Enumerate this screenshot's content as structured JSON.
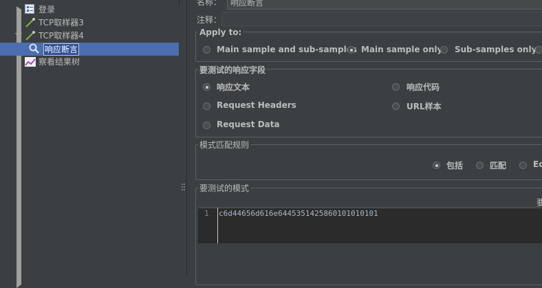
{
  "tree": {
    "items": [
      {
        "label": "登录"
      },
      {
        "label": "TCP取样器3"
      },
      {
        "label": "TCP取样器4"
      },
      {
        "label": "响应断言"
      },
      {
        "label": "察看结果树"
      }
    ]
  },
  "form": {
    "name_label": "名称：",
    "name_value": "响应断言",
    "comment_label": "注释："
  },
  "apply_to": {
    "title": "Apply to:",
    "options": [
      {
        "label": "Main sample and sub-samples",
        "selected": false
      },
      {
        "label": "Main sample only",
        "selected": true
      },
      {
        "label": "Sub-samples only",
        "selected": false
      }
    ]
  },
  "response_field": {
    "title": "要测试的响应字段",
    "options": [
      {
        "label": "响应文本",
        "selected": true
      },
      {
        "label": "响应代码",
        "selected": false
      },
      {
        "label": "Request Headers",
        "selected": false
      },
      {
        "label": "URL样本",
        "selected": false
      },
      {
        "label": "Request Data",
        "selected": false
      }
    ]
  },
  "pattern_rules": {
    "title": "模式匹配规则",
    "options": [
      {
        "label": "包括",
        "selected": true
      },
      {
        "label": "匹配",
        "selected": false
      },
      {
        "label": "Eq",
        "selected": false
      }
    ]
  },
  "patterns": {
    "title": "要测试的模式",
    "header_text": "要",
    "line_number": "1",
    "line_text": "c6d44656d616e6445351425860101010101"
  },
  "icons": {
    "tree": [
      "test-plan-icon",
      "sampler-icon",
      "sampler-icon",
      "assertion-icon",
      "listener-icon"
    ]
  }
}
